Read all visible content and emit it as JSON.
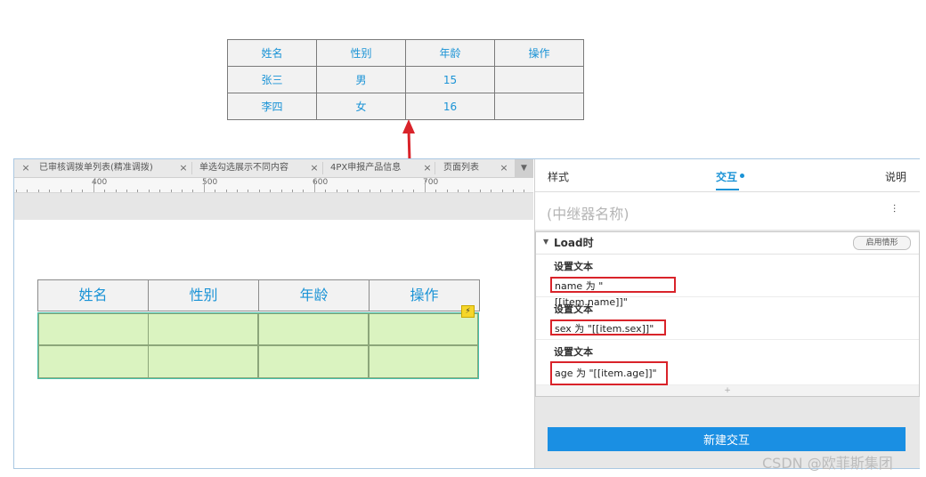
{
  "preview_table": {
    "header": [
      "姓名",
      "性别",
      "年龄",
      "操作"
    ],
    "rows": [
      [
        "张三",
        "男",
        "15",
        ""
      ],
      [
        "李四",
        "女",
        "16",
        ""
      ]
    ]
  },
  "arrow_color": "#d9232a",
  "editor": {
    "tabs": [
      {
        "close": "×",
        "label": "已审核调拨单列表(精准调拨)"
      },
      {
        "close": "×",
        "label": "单选勾选展示不同内容"
      },
      {
        "close": "×",
        "label": "4PX申报产品信息"
      },
      {
        "close": "×",
        "label": "页面列表"
      }
    ],
    "tab_overflow_close": "×",
    "ruler_labels": [
      "400",
      "500",
      "600",
      "700"
    ],
    "repeater": {
      "header": [
        "姓名",
        "性别",
        "年龄",
        "操作"
      ],
      "row_fill_color": "#daf3c0",
      "flash_icon": "⚡"
    }
  },
  "panel": {
    "tabs": {
      "style": "样式",
      "interaction": "交互",
      "notes": "说明"
    },
    "active_tab": "交互",
    "name_placeholder": "(中继器名称)",
    "settings_icon": "⫶",
    "event": {
      "title": "Load时",
      "enable_case_button": "启用情形",
      "actions": [
        {
          "label": "设置文本",
          "value": "name 为 \"[[item.name]]\""
        },
        {
          "label": "设置文本",
          "value": "sex 为 \"[[item.sex]]\""
        },
        {
          "label": "设置文本",
          "value": "age 为 \"[[item.age]]\""
        }
      ],
      "add_icon": "+"
    },
    "new_interaction_button": "新建交互",
    "accent_color": "#1a8fe3"
  },
  "watermark": "CSDN @欧菲斯集团"
}
